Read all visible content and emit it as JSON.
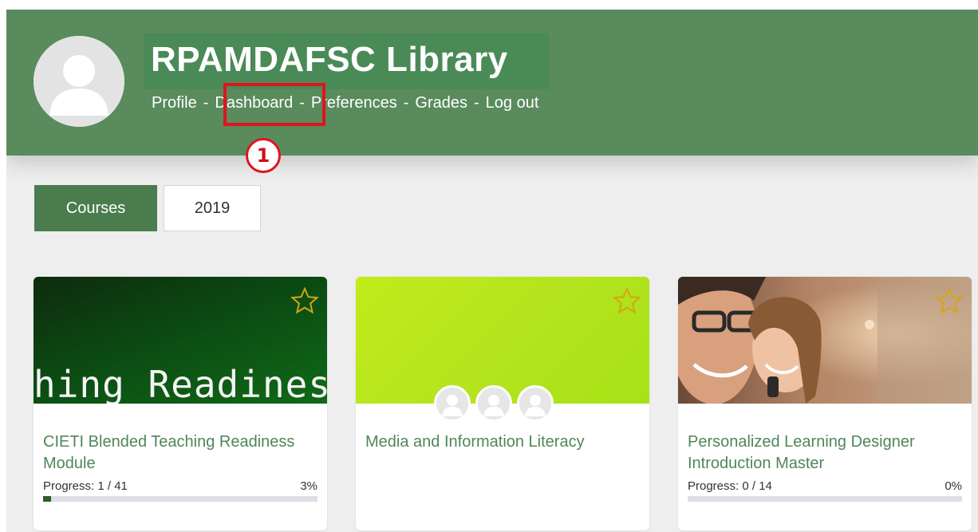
{
  "site": {
    "title": "RPAMDAFSC Library"
  },
  "nav": {
    "profile": "Profile",
    "dashboard": "Dashboard",
    "preferences": "Preferences",
    "grades": "Grades",
    "logout": "Log out",
    "separator": "-"
  },
  "annotation": {
    "step_number": "1",
    "color": "#e0141e"
  },
  "tabs": {
    "courses": "Courses",
    "year": "2019"
  },
  "courses": [
    {
      "name": "CIETI Blended Teaching Readiness Module",
      "banner_text": "hing Readiness",
      "progress_label": "Progress: 1 / 41",
      "progress_percent": "3%",
      "progress_fraction": 0.03,
      "starred": false
    },
    {
      "name": "Media and Information Literacy",
      "starred": false
    },
    {
      "name": "Personalized Learning Designer Introduction Master",
      "progress_label": "Progress: 0 / 14",
      "progress_percent": "0%",
      "progress_fraction": 0.0,
      "starred": false
    }
  ],
  "colors": {
    "header": "#598b5d",
    "accent": "#4a7c4e",
    "course_title": "#4f8659",
    "star": "#d4a514"
  }
}
